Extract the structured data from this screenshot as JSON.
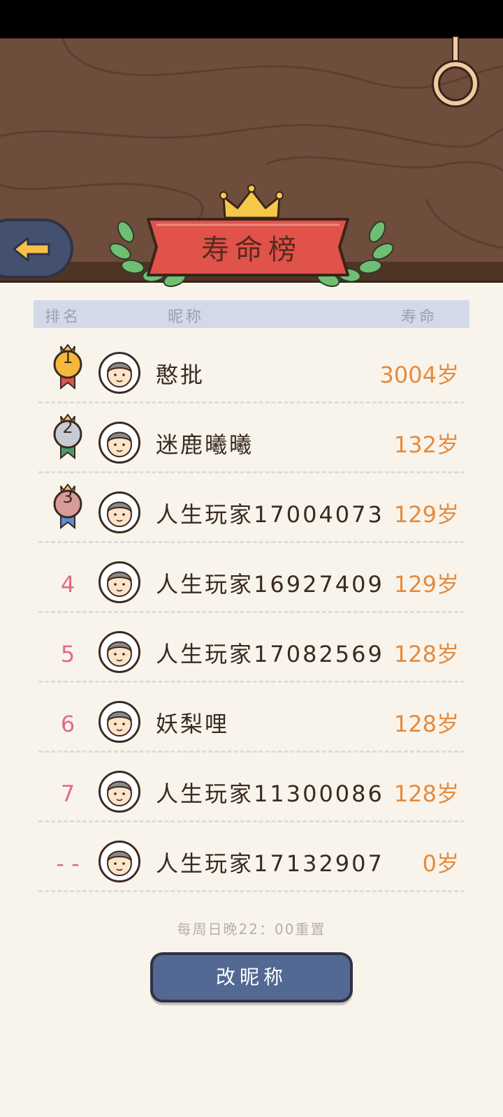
{
  "page_title": "寿命榜",
  "columns": {
    "rank": "排名",
    "nickname": "昵称",
    "lifespan": "寿命"
  },
  "rows": [
    {
      "rank": "",
      "medal": "gold",
      "name": "憨批",
      "life": "3004岁",
      "avatar": "grandma-icon"
    },
    {
      "rank": "",
      "medal": "silver",
      "name": "迷鹿曦曦",
      "life": "132岁",
      "avatar": "old-woman-icon"
    },
    {
      "rank": "",
      "medal": "bronze",
      "name": "人生玩家17004073",
      "life": "129岁",
      "avatar": "bald-old-man-icon"
    },
    {
      "rank": "4",
      "name": "人生玩家16927409",
      "life": "129岁",
      "avatar": "old-woman-icon"
    },
    {
      "rank": "5",
      "name": "人生玩家17082569",
      "life": "128岁",
      "avatar": "old-man-icon"
    },
    {
      "rank": "6",
      "name": "妖梨哩",
      "life": "128岁",
      "avatar": "woman-icon"
    },
    {
      "rank": "7",
      "name": "人生玩家11300086",
      "life": "128岁",
      "avatar": "bald-man-icon"
    },
    {
      "rank": "- -",
      "name": "人生玩家17132907",
      "life": "0岁",
      "avatar": "baby-icon"
    }
  ],
  "medal_numbers": {
    "gold": "1",
    "silver": "2",
    "bronze": "3"
  },
  "reset_note": "每周日晚22：00重置",
  "rename_button": "改昵称",
  "colors": {
    "wood": "#6e4d3c",
    "banner": "#e0524a",
    "life_text": "#e68a3c",
    "rank_text": "#e06b86",
    "button": "#536892"
  }
}
